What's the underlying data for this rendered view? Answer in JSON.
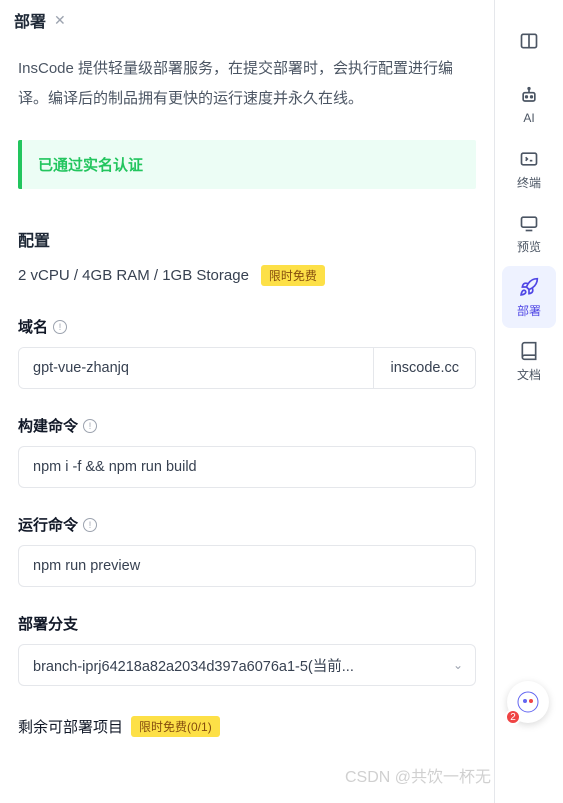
{
  "header": {
    "title": "部署"
  },
  "description": "InsCode 提供轻量级部署服务，在提交部署时，会执行配置进行编译。编译后的制品拥有更快的运行速度并永久在线。",
  "alert": {
    "text": "已通过实名认证"
  },
  "config": {
    "title": "配置",
    "spec": "2 vCPU / 4GB RAM / 1GB Storage",
    "badge": "限时免费"
  },
  "domain": {
    "label": "域名",
    "value": "gpt-vue-zhanjq",
    "suffix": "inscode.cc"
  },
  "build": {
    "label": "构建命令",
    "value": "npm i -f && npm run build"
  },
  "run": {
    "label": "运行命令",
    "value": "npm run preview"
  },
  "branch": {
    "label": "部署分支",
    "value": "branch-iprj64218a82a2034d397a6076a1-5(当前..."
  },
  "remain": {
    "label": "剩余可部署项目",
    "badge": "限时免费(0/1)"
  },
  "sidebar": {
    "items": [
      {
        "label": ""
      },
      {
        "label": "AI"
      },
      {
        "label": "终端"
      },
      {
        "label": "预览"
      },
      {
        "label": "部署"
      },
      {
        "label": "文档"
      }
    ]
  },
  "float": {
    "badge": "2"
  },
  "watermark": "CSDN @共饮一杯无"
}
